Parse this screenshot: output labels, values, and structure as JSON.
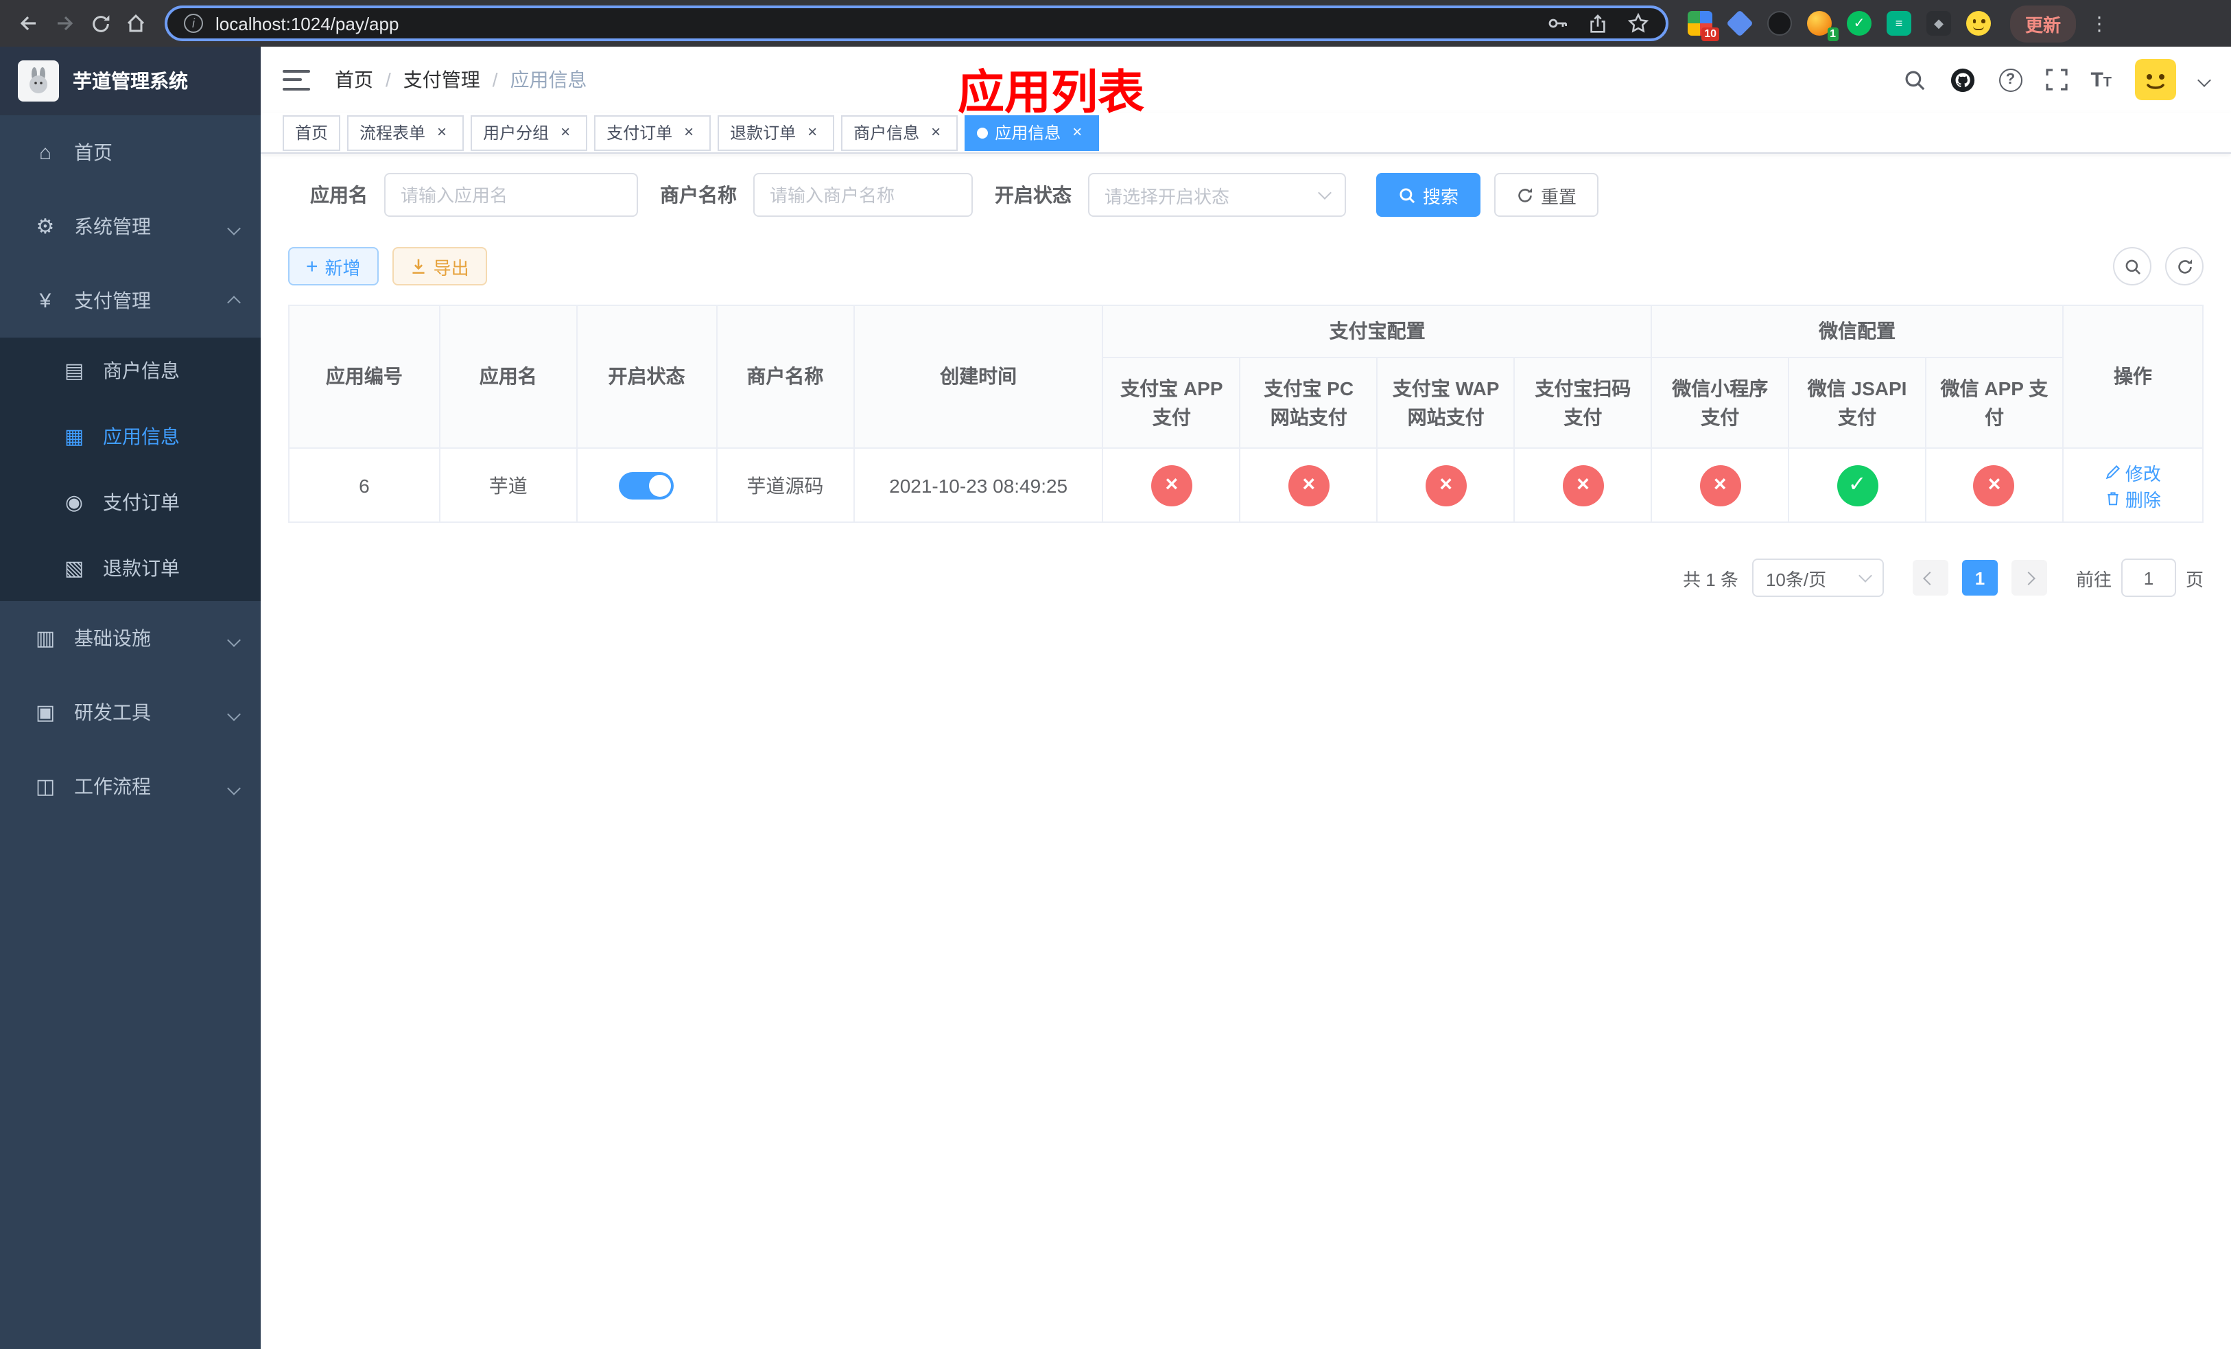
{
  "colors": {
    "primary": "#409eff",
    "success": "#13ce66",
    "danger": "#f56c6c",
    "warning": "#e6a23c",
    "annotation": "#ff0000",
    "sidebar_bg": "#304156",
    "submenu_bg": "#1f2d3d"
  },
  "browser": {
    "url": "localhost:1024/pay/app",
    "update_label": "更新",
    "ext_badge_blocks": "10",
    "ext_badge_avatar": "1"
  },
  "sidebar": {
    "title": "芋道管理系统",
    "items": [
      {
        "label": "首页"
      },
      {
        "label": "系统管理"
      },
      {
        "label": "支付管理"
      },
      {
        "label": "商户信息"
      },
      {
        "label": "应用信息"
      },
      {
        "label": "支付订单"
      },
      {
        "label": "退款订单"
      },
      {
        "label": "基础设施"
      },
      {
        "label": "研发工具"
      },
      {
        "label": "工作流程"
      }
    ]
  },
  "breadcrumb": {
    "items": [
      "首页",
      "支付管理",
      "应用信息"
    ]
  },
  "annotation": {
    "text": "应用列表"
  },
  "tabs": [
    {
      "label": "首页"
    },
    {
      "label": "流程表单"
    },
    {
      "label": "用户分组"
    },
    {
      "label": "支付订单"
    },
    {
      "label": "退款订单"
    },
    {
      "label": "商户信息"
    },
    {
      "label": "应用信息"
    }
  ],
  "filters": {
    "app_name": {
      "label": "应用名",
      "placeholder": "请输入应用名",
      "value": ""
    },
    "merchant_name": {
      "label": "商户名称",
      "placeholder": "请输入商户名称",
      "value": ""
    },
    "status": {
      "label": "开启状态",
      "placeholder": "请选择开启状态"
    },
    "search_label": "搜索",
    "reset_label": "重置"
  },
  "toolbar": {
    "add_label": "新增",
    "export_label": "导出"
  },
  "table": {
    "columns": {
      "app_id": "应用编号",
      "app_name": "应用名",
      "status": "开启状态",
      "merchant_name": "商户名称",
      "create_time": "创建时间",
      "alipay_group": "支付宝配置",
      "alipay_subs": [
        "支付宝 APP 支付",
        "支付宝 PC 网站支付",
        "支付宝 WAP 网站支付",
        "支付宝扫码支付"
      ],
      "wechat_group": "微信配置",
      "wechat_subs": [
        "微信小程序支付",
        "微信 JSAPI 支付",
        "微信 APP 支付"
      ],
      "actions": "操作"
    },
    "row": {
      "app_id": "6",
      "app_name": "芋道",
      "enabled": true,
      "merchant_name": "芋道源码",
      "create_time": "2021-10-23 08:49:25",
      "alipay_status": [
        "fail",
        "fail",
        "fail",
        "fail"
      ],
      "wechat_status": [
        "fail",
        "success",
        "fail"
      ],
      "edit_label": "修改",
      "delete_label": "删除"
    }
  },
  "pagination": {
    "total": "共 1 条",
    "page_size": "10条/页",
    "current_page": "1",
    "goto_label": "前往",
    "goto_value": "1",
    "page_unit": "页"
  }
}
